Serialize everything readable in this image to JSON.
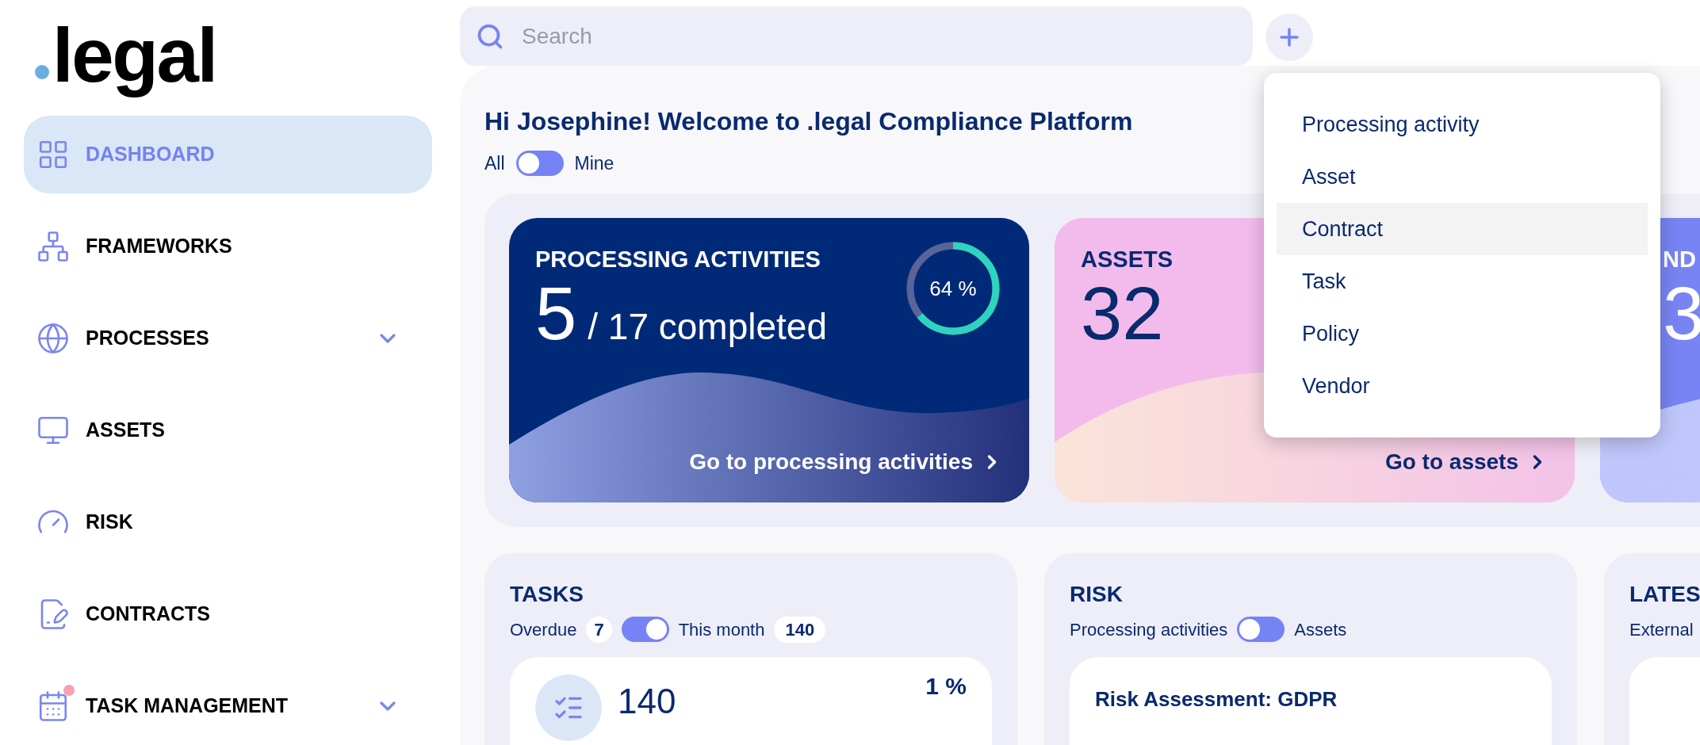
{
  "logo": {
    "text": "legal"
  },
  "sidebar": {
    "items": [
      {
        "label": "DASHBOARD",
        "kind": "grid",
        "selected": true,
        "expandable": false,
        "badge_dot": false
      },
      {
        "label": "FRAMEWORKS",
        "kind": "tree",
        "selected": false,
        "expandable": false,
        "badge_dot": false
      },
      {
        "label": "PROCESSES",
        "kind": "globe",
        "selected": false,
        "expandable": true,
        "badge_dot": false
      },
      {
        "label": "ASSETS",
        "kind": "monitor",
        "selected": false,
        "expandable": false,
        "badge_dot": false
      },
      {
        "label": "RISK",
        "kind": "gauge",
        "selected": false,
        "expandable": false,
        "badge_dot": false
      },
      {
        "label": "CONTRACTS",
        "kind": "contract",
        "selected": false,
        "expandable": false,
        "badge_dot": false
      },
      {
        "label": "TASK MANAGEMENT",
        "kind": "calendar",
        "selected": false,
        "expandable": true,
        "badge_dot": true
      }
    ]
  },
  "search": {
    "placeholder": "Search"
  },
  "add_menu": {
    "items": [
      {
        "label": "Processing activity",
        "selected": false
      },
      {
        "label": "Asset",
        "selected": false
      },
      {
        "label": "Contract",
        "selected": true
      },
      {
        "label": "Task",
        "selected": false
      },
      {
        "label": "Policy",
        "selected": false
      },
      {
        "label": "Vendor",
        "selected": false
      }
    ]
  },
  "welcome": {
    "heading": "Hi Josephine! Welcome to .legal Compliance Platform",
    "toggle": {
      "left_label": "All",
      "right_label": "Mine",
      "on": false
    }
  },
  "summary_cards": [
    {
      "kind": "dark",
      "title": "PROCESSING ACTIVITIES",
      "count": "5",
      "suffix": "/ 17 completed",
      "progress": {
        "level": 0.64,
        "label": "64 %"
      },
      "link": "Go to processing activities"
    },
    {
      "kind": "pink",
      "title": "ASSETS",
      "count": "32",
      "link": "Go to assets"
    },
    {
      "kind": "violet",
      "title": "ND",
      "count": "3"
    }
  ],
  "panels": [
    {
      "kind": "tasks",
      "title": "TASKS",
      "left_label": "Overdue",
      "left_count": "7",
      "toggle_on": true,
      "right_label": "This month",
      "right_count": "140",
      "total": "140",
      "percent": "1 %"
    },
    {
      "kind": "risk",
      "title": "RISK",
      "left_label": "Processing activities",
      "toggle_on": false,
      "right_label": "Assets",
      "item_title": "Risk Assessment: GDPR"
    },
    {
      "kind": "latest",
      "title": "LATES",
      "left_label": "External"
    }
  ]
}
